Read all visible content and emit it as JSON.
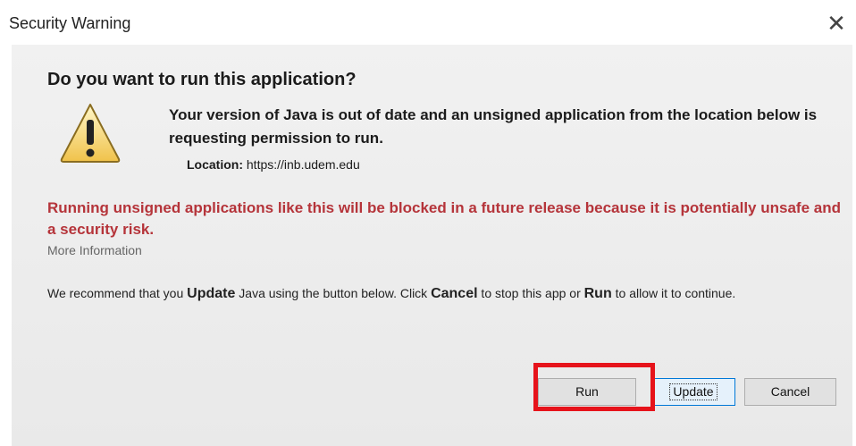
{
  "window": {
    "title": "Security Warning",
    "close_glyph": "✕"
  },
  "dialog": {
    "heading": "Do you want to run this application?",
    "icon": "warning-triangle-icon",
    "message": "Your version of Java is out of date and an unsigned application from the location below is requesting permission to run.",
    "location_label": "Location:",
    "location_value": "https://inb.udem.edu",
    "warning": "Running unsigned applications like this will be blocked in a future release because it is potentially unsafe and a security risk.",
    "more_info": "More Information",
    "recommend": {
      "part1": "We recommend that you ",
      "update_word": "Update",
      "part2": " Java using the button below. Click ",
      "cancel_word": "Cancel",
      "part3": " to stop this app or ",
      "run_word": "Run",
      "part4": " to allow it to continue."
    }
  },
  "buttons": {
    "run": "Run",
    "update": "Update",
    "cancel": "Cancel"
  },
  "colors": {
    "warning_text": "#b5343a",
    "highlight_box": "#e6131b"
  }
}
